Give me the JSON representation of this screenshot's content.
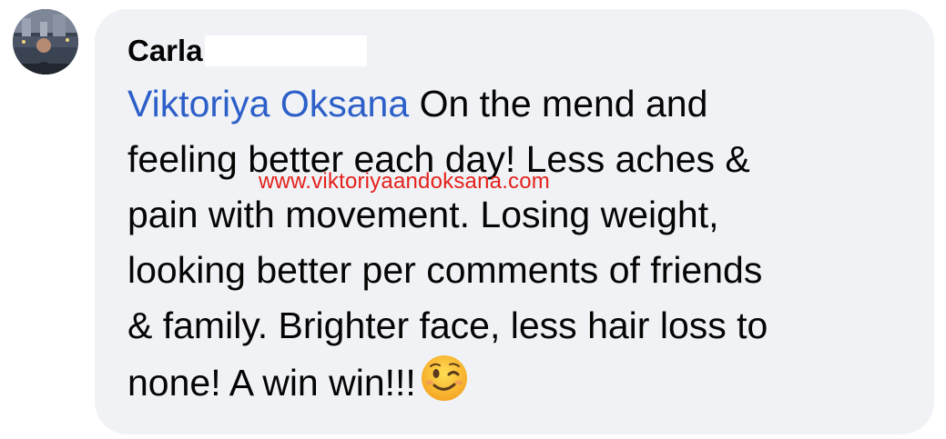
{
  "comment": {
    "author_name": "Carla",
    "mention": "Viktoriya Oksana",
    "lines": [
      " On the mend and",
      "feeling better each day!  Less aches &",
      "pain with movement.  Losing weight,",
      "looking better per comments of friends",
      "& family.  Brighter face, less hair loss to",
      "none!  A win win!!!"
    ],
    "emoji": "winking-face"
  },
  "watermark": {
    "text": "www.viktoriyaandoksana.com"
  },
  "colors": {
    "bubble": "#f0f2f5",
    "mention": "#2d5fc9",
    "watermark": "#e4211c",
    "text": "#050505"
  }
}
